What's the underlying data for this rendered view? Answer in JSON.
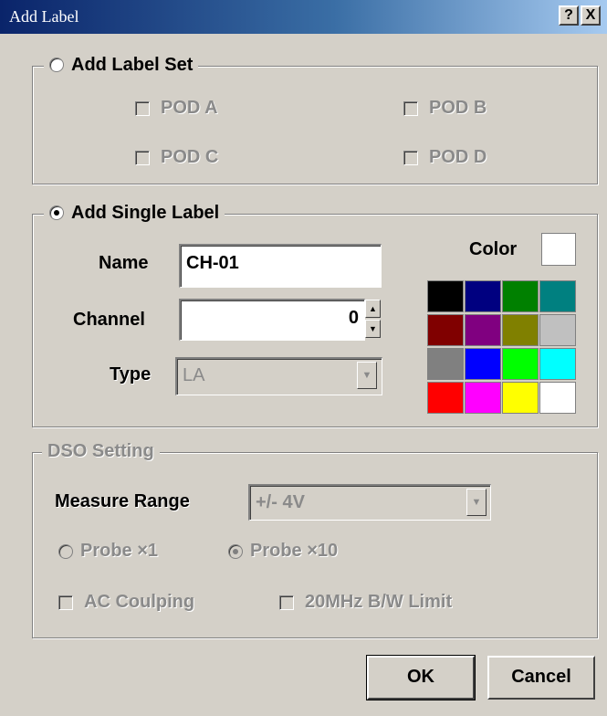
{
  "window": {
    "title": "Add Label",
    "help_label": "?",
    "close_label": "X"
  },
  "label_set": {
    "legend": "Add Label Set",
    "selected": false,
    "pods": [
      {
        "label": "POD A",
        "checked": false
      },
      {
        "label": "POD B",
        "checked": false
      },
      {
        "label": "POD C",
        "checked": false
      },
      {
        "label": "POD D",
        "checked": false
      }
    ]
  },
  "single_label": {
    "legend": "Add Single Label",
    "selected": true,
    "name_label": "Name",
    "name_value": "CH-01",
    "channel_label": "Channel",
    "channel_value": "0",
    "type_label": "Type",
    "type_value": "LA",
    "color_label": "Color",
    "selected_color": "#ffffff",
    "palette": [
      "#000000",
      "#000080",
      "#008000",
      "#008080",
      "#800000",
      "#800080",
      "#808000",
      "#c0c0c0",
      "#808080",
      "#0000ff",
      "#00ff00",
      "#00ffff",
      "#ff0000",
      "#ff00ff",
      "#ffff00",
      "#ffffff"
    ]
  },
  "dso": {
    "legend": "DSO Setting",
    "measure_label": "Measure Range",
    "measure_value": "+/- 4V",
    "probe_x1_label": "Probe ×1",
    "probe_x1_selected": false,
    "probe_x10_label": "Probe ×10",
    "probe_x10_selected": true,
    "ac_coupling_label": "AC Coulping",
    "ac_coupling_checked": false,
    "bw_limit_label": "20MHz B/W Limit",
    "bw_limit_checked": false
  },
  "buttons": {
    "ok": "OK",
    "cancel": "Cancel"
  }
}
